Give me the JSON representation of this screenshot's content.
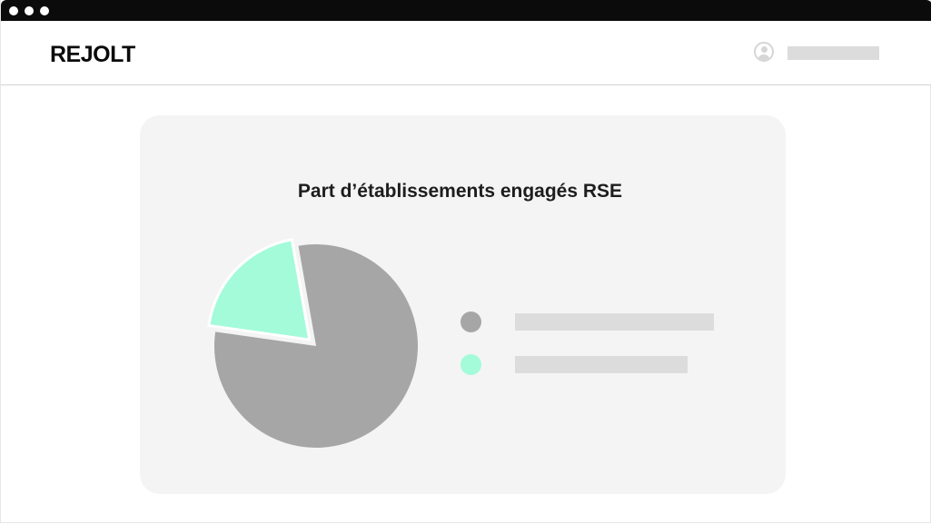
{
  "window": {
    "titlebar_dots": [
      "dot-1",
      "dot-2",
      "dot-3"
    ]
  },
  "header": {
    "logo": "REJOLT",
    "avatar_icon": "user-avatar-icon"
  },
  "chart_data": {
    "type": "pie",
    "title": "Part d’établissements engagés RSE",
    "slices": [
      {
        "value": 80,
        "color": "#a6a6a6"
      },
      {
        "value": 20,
        "color": "#a3fbd9",
        "exploded": true
      }
    ],
    "legend_position": "right"
  }
}
